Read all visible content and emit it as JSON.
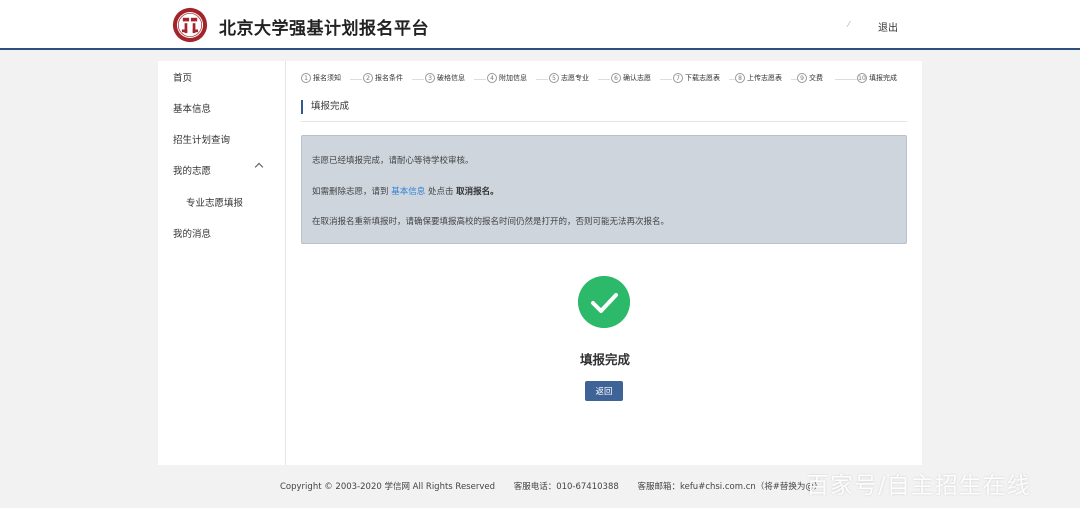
{
  "header": {
    "site_title": "北京大学强基计划报名平台",
    "user_mark": "⁄",
    "logout_label": "退出"
  },
  "sidebar": {
    "items": [
      {
        "label": "首页"
      },
      {
        "label": "基本信息"
      },
      {
        "label": "招生计划查询"
      },
      {
        "label": "我的志愿",
        "expanded": true
      },
      {
        "label": "专业志愿填报"
      },
      {
        "label": "我的消息"
      }
    ]
  },
  "steps": [
    {
      "num": "1",
      "label": "报名须知"
    },
    {
      "num": "2",
      "label": "报名条件"
    },
    {
      "num": "3",
      "label": "破格信息"
    },
    {
      "num": "4",
      "label": "附加信息"
    },
    {
      "num": "5",
      "label": "志愿专业"
    },
    {
      "num": "6",
      "label": "确认志愿"
    },
    {
      "num": "7",
      "label": "下载志愿表"
    },
    {
      "num": "8",
      "label": "上传志愿表"
    },
    {
      "num": "9",
      "label": "交费"
    },
    {
      "num": "10",
      "label": "填报完成"
    }
  ],
  "main": {
    "section_title": "填报完成",
    "notice": {
      "line1": "志愿已经填报完成，请耐心等待学校审核。",
      "line2_prefix": "如需删除志愿，请到",
      "line2_link": "基本信息",
      "line2_mid": "处点击",
      "line2_bold": "取消报名。",
      "line3": "在取消报名重新填报时，请确保要填报高校的报名时间仍然是打开的，否则可能无法再次报名。"
    },
    "success_text": "填报完成",
    "back_label": "返回"
  },
  "footer": {
    "copyright": "Copyright © 2003-2020 学信网 All Rights Reserved",
    "phone": "客服电话：010-67410388",
    "email": "客服邮箱：kefu#chsi.com.cn（将#替换为@）"
  },
  "watermark": "百家号/自主招生在线",
  "colors": {
    "accent": "#2f4f7f",
    "success": "#2cba6a",
    "button": "#3d6397",
    "notice_bg": "#ced5dd",
    "logo_red": "#a3252b"
  },
  "icons": {
    "logo": "peking-university-seal-icon",
    "success": "check-circle-icon",
    "chevron": "chevron-up-icon"
  }
}
